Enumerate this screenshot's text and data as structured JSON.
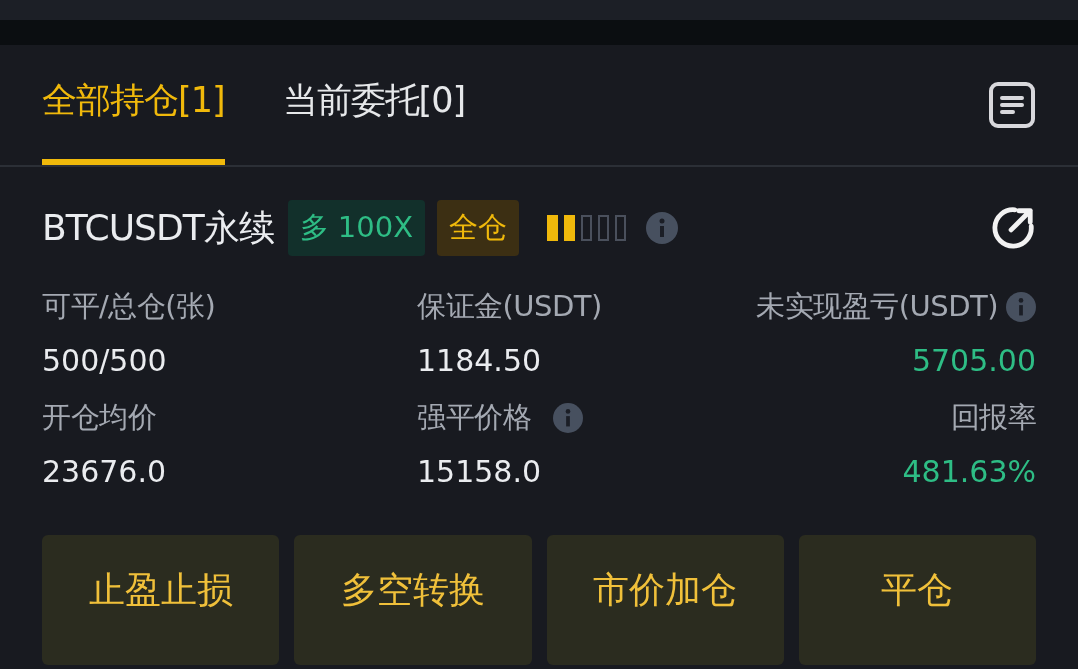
{
  "tabs": [
    {
      "label": "全部持仓[1]",
      "selected": true
    },
    {
      "label": "当前委托[0]",
      "selected": false
    }
  ],
  "position": {
    "symbol": "BTCUSDT永续",
    "side_badge": "多 100X",
    "margin_badge": "全仓",
    "risk": [
      {
        "lit": true
      },
      {
        "lit": true
      },
      {
        "lit": false
      },
      {
        "lit": false
      },
      {
        "lit": false
      }
    ],
    "fields": [
      {
        "label": "可平/总仓(张)",
        "value": "500/500",
        "info": false,
        "color": "#eaecef"
      },
      {
        "label": "保证金(USDT)",
        "value": "1184.50",
        "info": false,
        "color": "#eaecef"
      },
      {
        "label": "未实现盈亏(USDT)",
        "value": "5705.00",
        "info": true,
        "color": "#2ebd85"
      },
      {
        "label": "开仓均价",
        "value": "23676.0",
        "info": false,
        "color": "#eaecef"
      },
      {
        "label": "强平价格",
        "value": "15158.0",
        "info": true,
        "color": "#eaecef"
      },
      {
        "label": "回报率",
        "value": "481.63%",
        "info": false,
        "color": "#2ebd85"
      }
    ]
  },
  "buttons": [
    "止盈止损",
    "多空转换",
    "市价加仓",
    "平仓"
  ]
}
